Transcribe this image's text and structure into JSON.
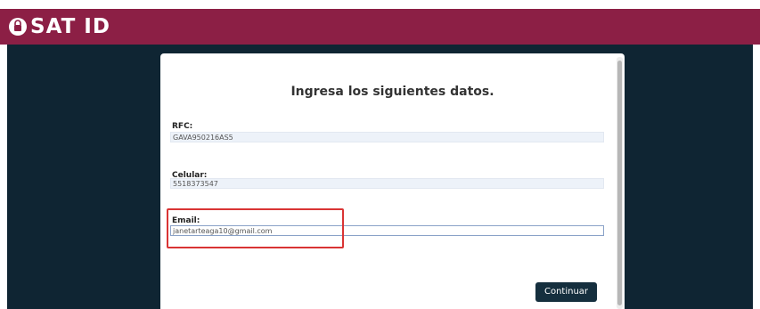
{
  "header": {
    "title": "SAT ID",
    "brand_color": "#8c1f45",
    "logo_icon": "lock-icon"
  },
  "form": {
    "title": "Ingresa los siguientes datos.",
    "fields": [
      {
        "label": "RFC:",
        "value": "GAVA950216AS5"
      },
      {
        "label": "Celular:",
        "value": "5518373547"
      },
      {
        "label": "Email:",
        "value": "janetarteaga10@gmail.com"
      }
    ],
    "continue_label": "Continuar"
  },
  "colors": {
    "backdrop": "#0f2533",
    "highlight": "#d93434",
    "button": "#152f3e"
  }
}
